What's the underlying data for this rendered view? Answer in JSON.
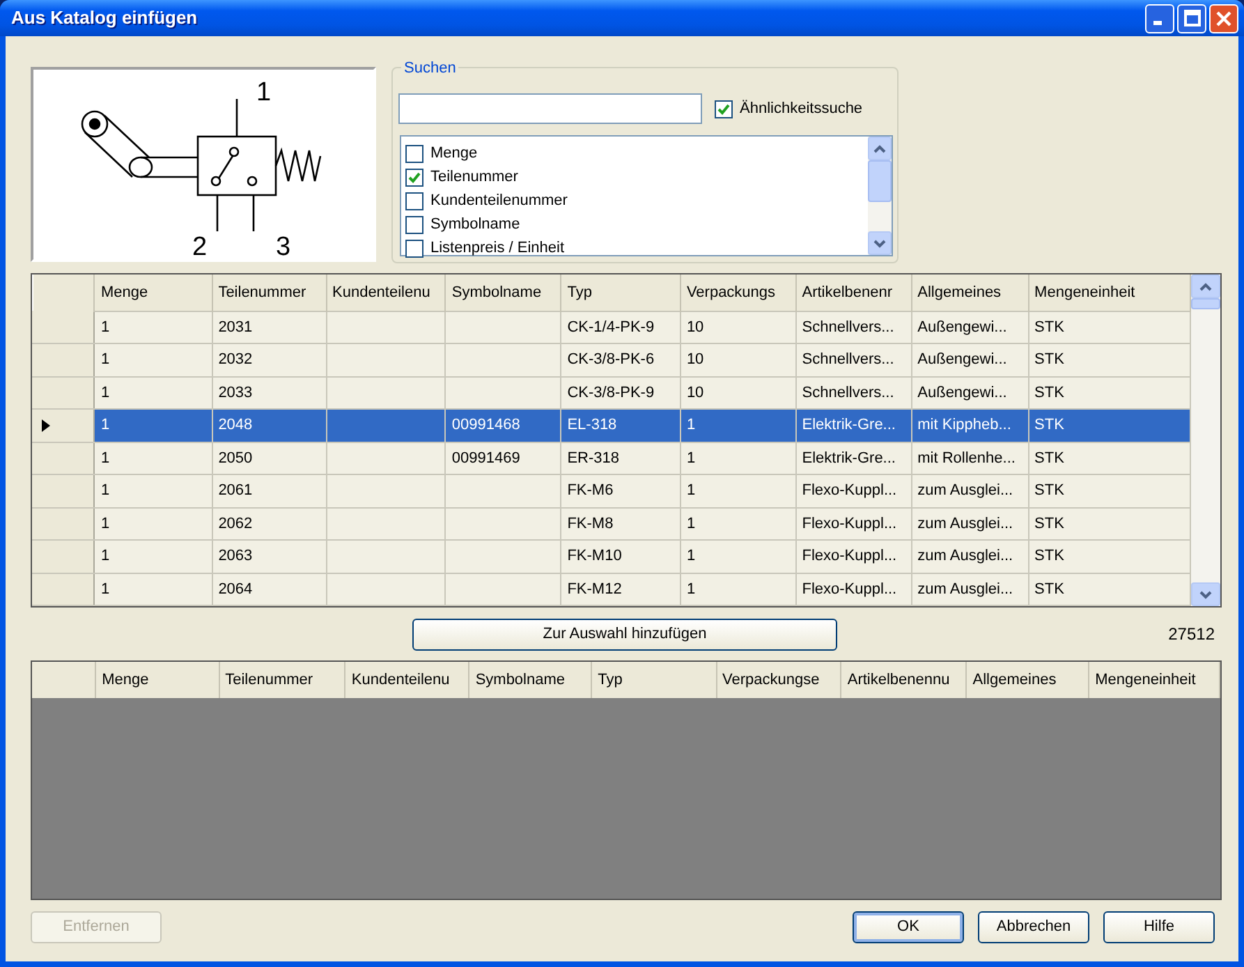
{
  "window": {
    "title": "Aus Katalog einfügen"
  },
  "preview": {
    "port_labels": [
      "1",
      "2",
      "3"
    ]
  },
  "search": {
    "legend": "Suchen",
    "similarity": {
      "label": "Ähnlichkeitssuche",
      "checked": true
    },
    "fields": [
      {
        "label": "Menge",
        "checked": false
      },
      {
        "label": "Teilenummer",
        "checked": true
      },
      {
        "label": "Kundenteilenummer",
        "checked": false
      },
      {
        "label": "Symbolname",
        "checked": false
      },
      {
        "label": "Listenpreis / Einheit",
        "checked": false
      }
    ]
  },
  "catalog_table": {
    "columns": [
      "Menge",
      "Teilenummer",
      "Kundenteilenu",
      "Symbolname",
      "Typ",
      "Verpackungs",
      "Artikelbenenr",
      "Allgemeines",
      "Mengeneinheit"
    ],
    "rows": [
      {
        "selected": false,
        "cells": [
          "1",
          "2031",
          null,
          null,
          "CK-1/4-PK-9",
          "10",
          "Schnellvers...",
          "Außengewi...",
          "STK"
        ]
      },
      {
        "selected": false,
        "cells": [
          "1",
          "2032",
          null,
          null,
          "CK-3/8-PK-6",
          "10",
          "Schnellvers...",
          "Außengewi...",
          "STK"
        ]
      },
      {
        "selected": false,
        "cells": [
          "1",
          "2033",
          null,
          null,
          "CK-3/8-PK-9",
          "10",
          "Schnellvers...",
          "Außengewi...",
          "STK"
        ]
      },
      {
        "selected": true,
        "cells": [
          "1",
          "2048",
          null,
          "00991468",
          "EL-318",
          "1",
          "Elektrik-Gre...",
          "mit Kippheb...",
          "STK"
        ]
      },
      {
        "selected": false,
        "cells": [
          "1",
          "2050",
          null,
          "00991469",
          "ER-318",
          "1",
          "Elektrik-Gre...",
          "mit Rollenhe...",
          "STK"
        ]
      },
      {
        "selected": false,
        "cells": [
          "1",
          "2061",
          null,
          null,
          "FK-M6",
          "1",
          "Flexo-Kuppl...",
          "zum Ausglei...",
          "STK"
        ]
      },
      {
        "selected": false,
        "cells": [
          "1",
          "2062",
          null,
          null,
          "FK-M8",
          "1",
          "Flexo-Kuppl...",
          "zum Ausglei...",
          "STK"
        ]
      },
      {
        "selected": false,
        "cells": [
          "1",
          "2063",
          null,
          null,
          "FK-M10",
          "1",
          "Flexo-Kuppl...",
          "zum Ausglei...",
          "STK"
        ]
      },
      {
        "selected": false,
        "cells": [
          "1",
          "2064",
          null,
          null,
          "FK-M12",
          "1",
          "Flexo-Kuppl...",
          "zum Ausglei...",
          "STK"
        ]
      }
    ]
  },
  "add_button": "Zur Auswahl hinzufügen",
  "count": "27512",
  "selection_table": {
    "columns": [
      "Menge",
      "Teilenummer",
      "Kundenteilenu",
      "Symbolname",
      "Typ",
      "Verpackungse",
      "Artikelbenennu",
      "Allgemeines",
      "Mengeneinheit"
    ]
  },
  "buttons": [
    {
      "label": "Entfernen",
      "disabled": true,
      "default": false
    },
    {
      "label": "OK",
      "disabled": false,
      "default": true
    },
    {
      "label": "Abbrechen",
      "disabled": false,
      "default": false
    },
    {
      "label": "Hilfe",
      "disabled": false,
      "default": false
    }
  ]
}
